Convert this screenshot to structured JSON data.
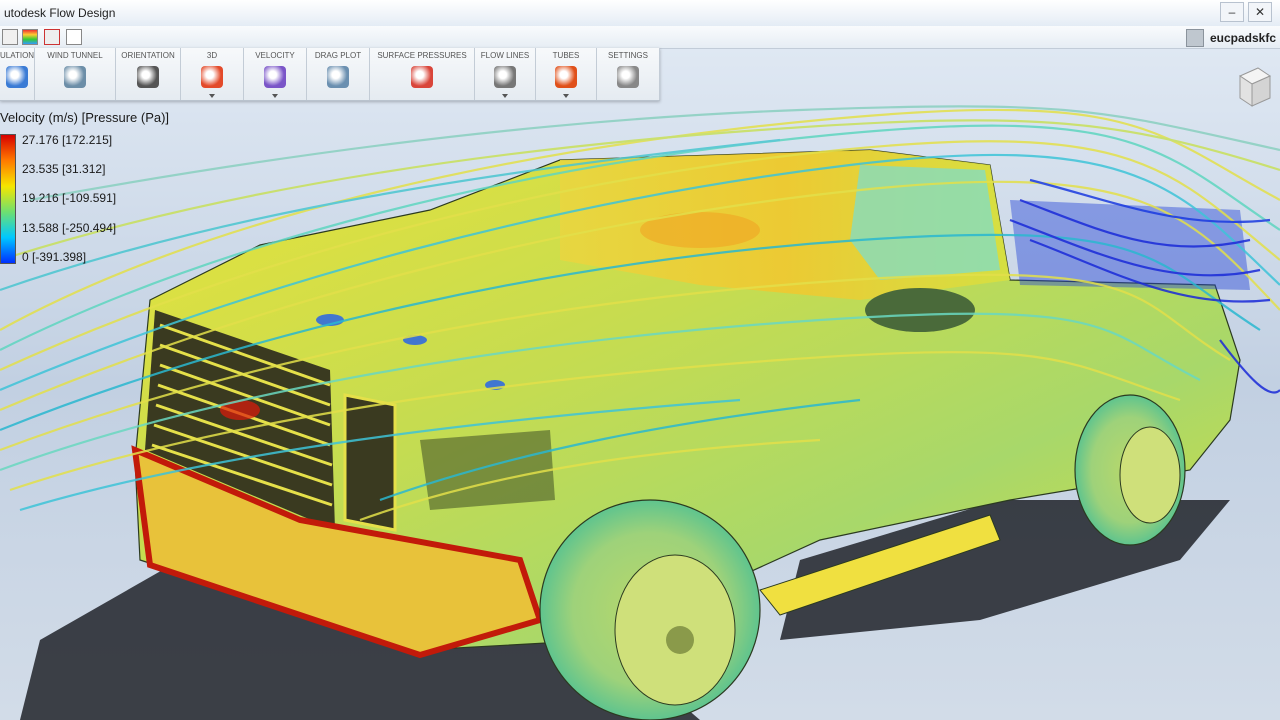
{
  "window": {
    "title": "utodesk Flow Design"
  },
  "user": {
    "name": "eucpadskfc"
  },
  "ribbon": [
    {
      "label": "ULATION",
      "icon": "simulation-icon",
      "dropdown": false
    },
    {
      "label": "WIND TUNNEL",
      "icon": "wind-tunnel-icon",
      "dropdown": false
    },
    {
      "label": "ORIENTATION",
      "icon": "orientation-icon",
      "dropdown": false
    },
    {
      "label": "3D",
      "icon": "3d-view-icon",
      "dropdown": true
    },
    {
      "label": "VELOCITY",
      "icon": "velocity-icon",
      "dropdown": true
    },
    {
      "label": "DRAG PLOT",
      "icon": "drag-plot-icon",
      "dropdown": false
    },
    {
      "label": "SURFACE PRESSURES",
      "icon": "surface-pressures-icon",
      "dropdown": false
    },
    {
      "label": "FLOW LINES",
      "icon": "flow-lines-icon",
      "dropdown": true
    },
    {
      "label": "TUBES",
      "icon": "tubes-icon",
      "dropdown": true
    },
    {
      "label": "SETTINGS",
      "icon": "settings-icon",
      "dropdown": false
    }
  ],
  "legend": {
    "title": "Velocity (m/s) [Pressure (Pa)]",
    "ticks": [
      "27.176 [172.215]",
      "23.535 [31.312]",
      "19.216 [-109.591]",
      "13.588 [-250.494]",
      "0 [-391.398]"
    ]
  },
  "colors": {
    "high": "#d70000",
    "mid": "#f5e600",
    "low": "#0030ff",
    "truck": "#c9dd55"
  }
}
